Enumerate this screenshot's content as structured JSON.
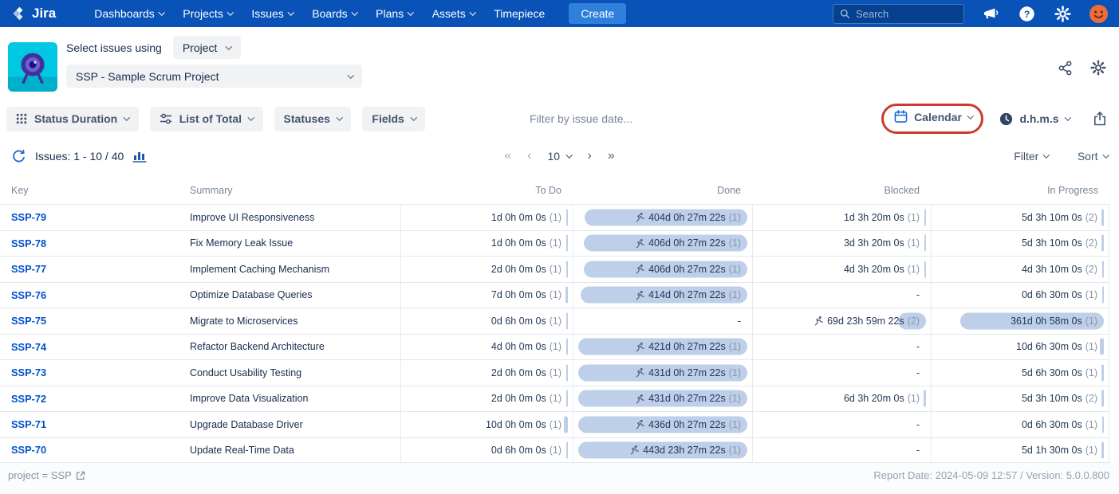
{
  "colors": {
    "navbar_blue": "#0852B8",
    "create_blue": "#2F80DB",
    "link_blue": "#0052CC",
    "pill_blue": "#BECFE9",
    "annotation_red": "#CC3A2E",
    "app_teal": "#00C7E2",
    "app_purple": "#403294",
    "avatar_orange": "#EE6B3B",
    "text_dark": "#172B4D",
    "text_muted": "#7A869A"
  },
  "icons": {
    "search": "magnifier",
    "feedback": "megaphone",
    "help": "question-circle",
    "settings": "gear",
    "profile": "avatar-face",
    "share": "share-nodes",
    "status_duration": "grid-dots",
    "list_of_total": "sliders",
    "calendar": "calendar",
    "time_format": "clock",
    "export": "export-arrow",
    "refresh": "circular-arrows",
    "chart": "bar-chart",
    "runner": "running-person",
    "external_link": "external-link"
  },
  "navbar": {
    "brand": "Jira",
    "menu": [
      "Dashboards",
      "Projects",
      "Issues",
      "Boards",
      "Plans",
      "Assets",
      "Timepiece"
    ],
    "create_label": "Create",
    "search_placeholder": "Search"
  },
  "header": {
    "select_issues_label": "Select issues using",
    "issue_source": "Project",
    "project": "SSP - Sample Scrum Project"
  },
  "toolbar": {
    "status_duration_label": "Status Duration",
    "list_of_total_label": "List of Total",
    "statuses_label": "Statuses",
    "fields_label": "Fields",
    "date_filter_placeholder": "Filter by issue date...",
    "calendar_label": "Calendar",
    "time_format_label": "d.h.m.s"
  },
  "pagination": {
    "issues_count": "Issues: 1 - 10 / 40",
    "first": "«",
    "prev": "‹",
    "page_size": "10",
    "next": "›",
    "last": "»",
    "filter_label": "Filter",
    "sort_label": "Sort"
  },
  "table": {
    "columns": [
      "Key",
      "Summary",
      "To Do",
      "Done",
      "Blocked",
      "In Progress"
    ],
    "rows": [
      {
        "key": "SSP-79",
        "summary": "Improve UI Responsiveness",
        "todo": {
          "text": "1d 0h 0m 0s",
          "count": "(1)",
          "bar": 0.003
        },
        "done": {
          "text": "404d 0h 27m 22s",
          "count": "(1)",
          "bar": 0.91,
          "runner": true
        },
        "blocked": {
          "text": "1d 3h 20m 0s",
          "count": "(1)",
          "bar": 0.003
        },
        "inprogress": {
          "text": "5d 3h 10m 0s",
          "count": "(2)",
          "bar": 0.012
        }
      },
      {
        "key": "SSP-78",
        "summary": "Fix Memory Leak Issue",
        "todo": {
          "text": "1d 0h 0m 0s",
          "count": "(1)",
          "bar": 0.003
        },
        "done": {
          "text": "406d 0h 27m 22s",
          "count": "(1)",
          "bar": 0.915,
          "runner": true
        },
        "blocked": {
          "text": "3d 3h 20m 0s",
          "count": "(1)",
          "bar": 0.007
        },
        "inprogress": {
          "text": "5d 3h 10m 0s",
          "count": "(2)",
          "bar": 0.012
        }
      },
      {
        "key": "SSP-77",
        "summary": "Implement Caching Mechanism",
        "todo": {
          "text": "2d 0h 0m 0s",
          "count": "(1)",
          "bar": 0.005
        },
        "done": {
          "text": "406d 0h 27m 22s",
          "count": "(1)",
          "bar": 0.915,
          "runner": true
        },
        "blocked": {
          "text": "4d 3h 20m 0s",
          "count": "(1)",
          "bar": 0.009
        },
        "inprogress": {
          "text": "4d 3h 10m 0s",
          "count": "(2)",
          "bar": 0.01
        }
      },
      {
        "key": "SSP-76",
        "summary": "Optimize Database Queries",
        "todo": {
          "text": "7d 0h 0m 0s",
          "count": "(1)",
          "bar": 0.016
        },
        "done": {
          "text": "414d 0h 27m 22s",
          "count": "(1)",
          "bar": 0.933,
          "runner": true
        },
        "blocked": {
          "text": "-"
        },
        "inprogress": {
          "text": "0d 6h 30m 0s",
          "count": "(1)",
          "bar": 0.002
        }
      },
      {
        "key": "SSP-75",
        "summary": "Migrate to Microservices",
        "todo": {
          "text": "0d 6h 0m 0s",
          "count": "(1)",
          "bar": 0.002
        },
        "done": {
          "text": "-"
        },
        "blocked": {
          "text": "69d 23h 59m 22s",
          "count": "(2)",
          "bar": 0.158,
          "runner": true
        },
        "inprogress": {
          "text": "361d 0h 58m 0s",
          "count": "(1)",
          "bar": 0.813
        }
      },
      {
        "key": "SSP-74",
        "summary": "Refactor Backend Architecture",
        "todo": {
          "text": "4d 0h 0m 0s",
          "count": "(1)",
          "bar": 0.009
        },
        "done": {
          "text": "421d 0h 27m 22s",
          "count": "(1)",
          "bar": 0.949,
          "runner": true
        },
        "blocked": {
          "text": "-"
        },
        "inprogress": {
          "text": "10d 6h 30m 0s",
          "count": "(1)",
          "bar": 0.023
        }
      },
      {
        "key": "SSP-73",
        "summary": "Conduct Usability Testing",
        "todo": {
          "text": "2d 0h 0m 0s",
          "count": "(1)",
          "bar": 0.005
        },
        "done": {
          "text": "431d 0h 27m 22s",
          "count": "(1)",
          "bar": 0.971,
          "runner": true
        },
        "blocked": {
          "text": "-"
        },
        "inprogress": {
          "text": "5d 6h 30m 0s",
          "count": "(1)",
          "bar": 0.012
        }
      },
      {
        "key": "SSP-72",
        "summary": "Improve Data Visualization",
        "todo": {
          "text": "2d 0h 0m 0s",
          "count": "(1)",
          "bar": 0.005
        },
        "done": {
          "text": "431d 0h 27m 22s",
          "count": "(1)",
          "bar": 0.971,
          "runner": true
        },
        "blocked": {
          "text": "6d 3h 20m 0s",
          "count": "(1)",
          "bar": 0.014
        },
        "inprogress": {
          "text": "5d 3h 10m 0s",
          "count": "(2)",
          "bar": 0.012
        }
      },
      {
        "key": "SSP-71",
        "summary": "Upgrade Database Driver",
        "todo": {
          "text": "10d 0h 0m 0s",
          "count": "(1)",
          "bar": 0.023
        },
        "done": {
          "text": "436d 0h 27m 22s",
          "count": "(1)",
          "bar": 0.982,
          "runner": true
        },
        "blocked": {
          "text": "-"
        },
        "inprogress": {
          "text": "0d 6h 30m 0s",
          "count": "(1)",
          "bar": 0.002
        }
      },
      {
        "key": "SSP-70",
        "summary": "Update Real-Time Data",
        "todo": {
          "text": "0d 6h 0m 0s",
          "count": "(1)",
          "bar": 0.002
        },
        "done": {
          "text": "443d 23h 27m 22s",
          "count": "(1)",
          "bar": 0.999,
          "runner": true
        },
        "blocked": {
          "text": "-"
        },
        "inprogress": {
          "text": "5d 1h 30m 0s",
          "count": "(1)",
          "bar": 0.012
        }
      }
    ]
  },
  "footer": {
    "query": "project = SSP",
    "report_info": "Report Date: 2024-05-09 12:57 / Version: 5.0.0.800"
  }
}
